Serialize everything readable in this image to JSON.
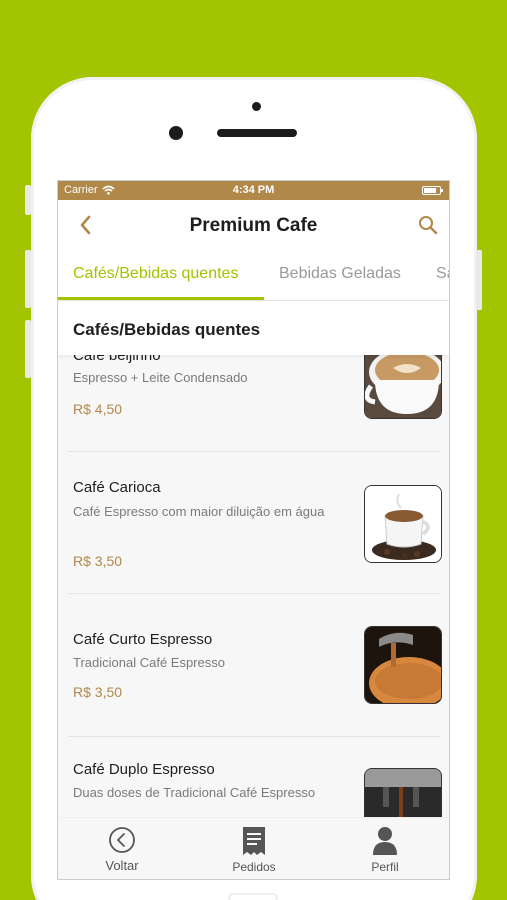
{
  "status_bar": {
    "carrier": "Carrier",
    "time": "4:34 PM"
  },
  "header": {
    "title": "Premium Cafe"
  },
  "tabs": [
    {
      "label": "Cafés/Bebidas quentes",
      "active": true
    },
    {
      "label": "Bebidas Geladas",
      "active": false
    },
    {
      "label": "Sa",
      "active": false
    }
  ],
  "section": {
    "title": "Cafés/Bebidas quentes"
  },
  "products": [
    {
      "name": "Café beijinho",
      "description": "Espresso + Leite Condensado",
      "price": "R$ 4,50"
    },
    {
      "name": "Café Carioca",
      "description": "Café Espresso com maior diluição em água",
      "price": "R$ 3,50"
    },
    {
      "name": "Café Curto Espresso",
      "description": "Tradicional Café Espresso",
      "price": "R$ 3,50"
    },
    {
      "name": "Café Duplo Espresso",
      "description": "Duas doses de Tradicional Café Espresso",
      "price": ""
    }
  ],
  "tabbar": {
    "voltar": "Voltar",
    "pedidos": "Pedidos",
    "perfil": "Perfil"
  },
  "colors": {
    "brand_green": "#a3c400",
    "status_brown": "#b0884a",
    "price_gold": "#b0884a"
  },
  "icons": {
    "back": "chevron-left-icon",
    "search": "search-icon",
    "voltar": "circle-chevron-left-icon",
    "pedidos": "receipt-icon",
    "perfil": "user-icon"
  }
}
